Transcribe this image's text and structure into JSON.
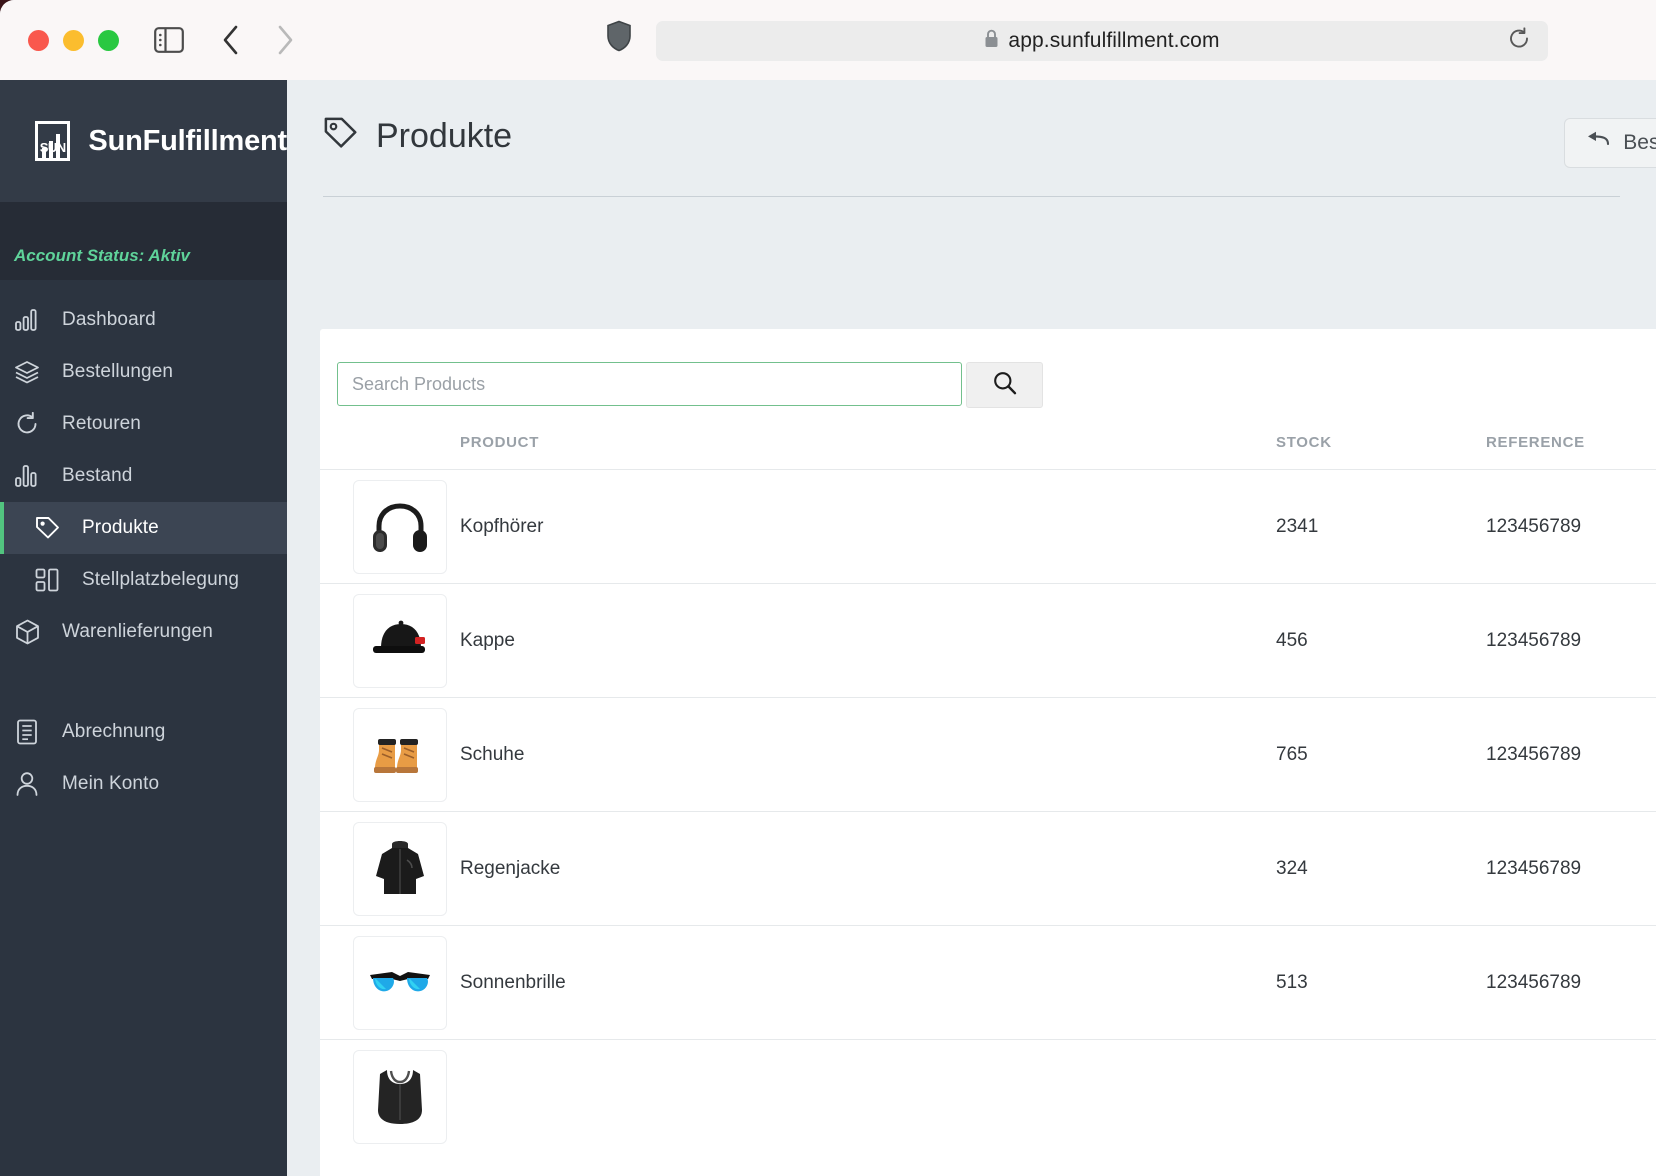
{
  "browser": {
    "traffic_lights": [
      "close",
      "minimize",
      "maximize"
    ],
    "sidebar_toggle_icon": "sidebar-panel-icon",
    "back_icon": "chevron-left-icon",
    "forward_icon": "chevron-right-icon",
    "shield_icon": "shield-icon",
    "lock_icon": "lock-icon",
    "url": "app.sunfulfillment.com",
    "reload_icon": "reload-icon"
  },
  "sidebar": {
    "brand": {
      "mark_text": "SUN",
      "name": "SunFulfillment"
    },
    "account_status": "Account Status: Aktiv",
    "accent_color": "#52c47f",
    "status_color": "#5fd39a",
    "items": [
      {
        "label": "Dashboard",
        "icon": "bar-chart-icon",
        "level": "top",
        "active": false
      },
      {
        "label": "Bestellungen",
        "icon": "layers-icon",
        "level": "top",
        "active": false
      },
      {
        "label": "Retouren",
        "icon": "refresh-icon",
        "level": "top",
        "active": false
      },
      {
        "label": "Bestand",
        "icon": "bar-chart-alt-icon",
        "level": "top",
        "active": false
      },
      {
        "label": "Produkte",
        "icon": "tag-icon",
        "level": "sub",
        "active": true
      },
      {
        "label": "Stellplatzbelegung",
        "icon": "layout-grid-icon",
        "level": "sub",
        "active": false
      },
      {
        "label": "Warenlieferungen",
        "icon": "box-icon",
        "level": "top",
        "active": false
      },
      {
        "label": "Abrechnung",
        "icon": "document-icon",
        "level": "top",
        "active": false
      },
      {
        "label": "Mein Konto",
        "icon": "user-icon",
        "level": "top",
        "active": false
      }
    ]
  },
  "page": {
    "title": "Produkte",
    "title_icon": "tag-icon",
    "action_button": {
      "label": "Bestä",
      "icon": "arrow-back-icon"
    }
  },
  "search": {
    "placeholder": "Search Products",
    "value": "",
    "button_icon": "search-icon",
    "border_color": "#73c08d"
  },
  "table": {
    "columns": [
      "PRODUCT",
      "STOCK",
      "REFERENCE"
    ],
    "rows": [
      {
        "name": "Kopfhörer",
        "stock": "2341",
        "reference": "123456789",
        "image": "headphones-image"
      },
      {
        "name": "Kappe",
        "stock": "456",
        "reference": "123456789",
        "image": "cap-image"
      },
      {
        "name": "Schuhe",
        "stock": "765",
        "reference": "123456789",
        "image": "boots-image"
      },
      {
        "name": "Regenjacke",
        "stock": "324",
        "reference": "123456789",
        "image": "rain-jacket-image"
      },
      {
        "name": "Sonnenbrille",
        "stock": "513",
        "reference": "123456789",
        "image": "sunglasses-image"
      },
      {
        "name": "",
        "stock": "",
        "reference": "",
        "image": "sports-top-image"
      }
    ]
  }
}
